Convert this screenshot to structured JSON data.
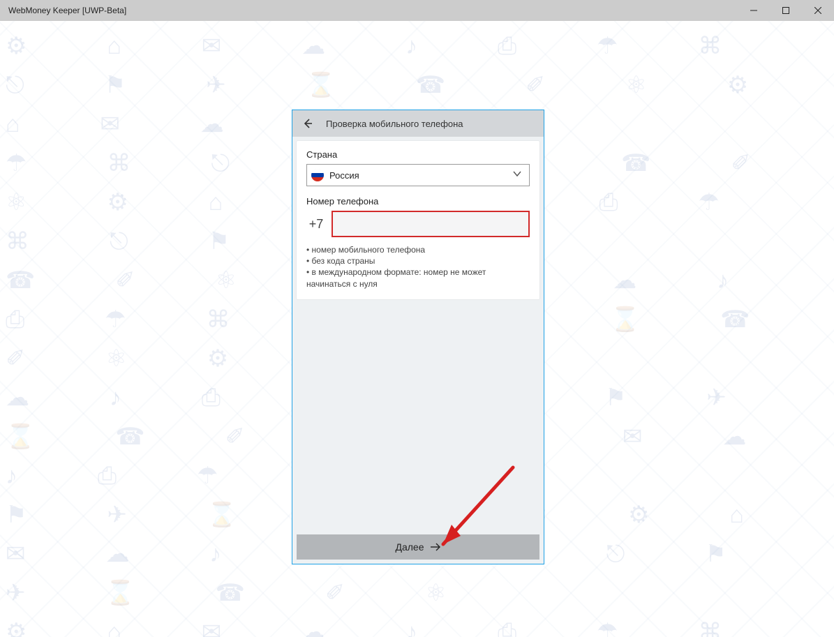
{
  "window": {
    "title": "WebMoney Keeper [UWP-Beta]"
  },
  "dialog": {
    "title": "Проверка мобильного телефона",
    "country_label": "Страна",
    "country_value": "Россия",
    "phone_label": "Номер телефона",
    "phone_prefix": "+7",
    "phone_value": "",
    "hints": [
      "• номер мобильного телефона",
      "• без кода страны",
      "• в международном формате: номер не может начинаться с нуля"
    ],
    "next_label": "Далее"
  }
}
